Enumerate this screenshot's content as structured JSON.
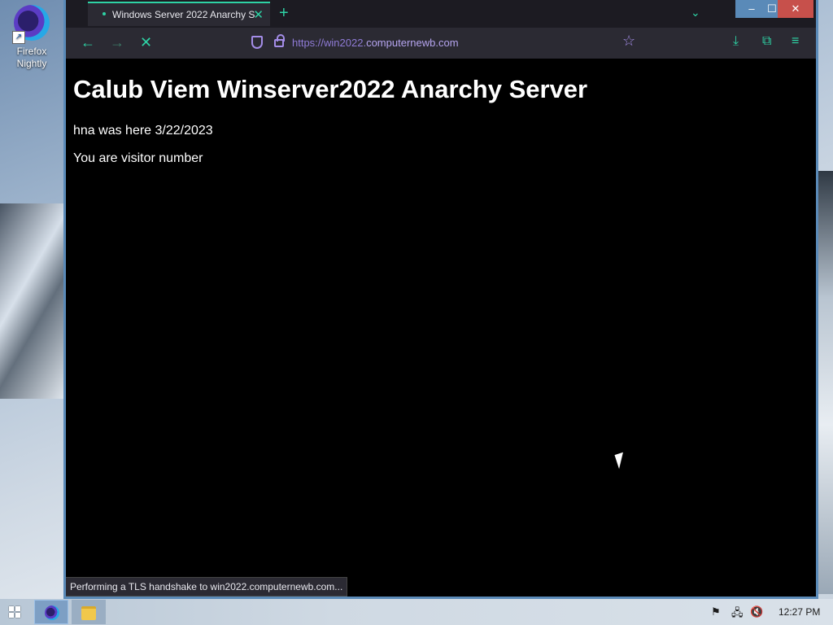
{
  "desktop": {
    "icon_label_line1": "Firefox",
    "icon_label_line2": "Nightly"
  },
  "browser": {
    "tab_title": "Windows Server 2022 Anarchy S",
    "url_scheme": "https://",
    "url_sub": "win2022.",
    "url_host": "computernewb.com",
    "status_text": "Performing a TLS handshake to win2022.computernewb.com..."
  },
  "page": {
    "heading": "Calub Viem Winserver2022 Anarchy Server",
    "line1": "hna was here 3/22/2023",
    "line2": "You are visitor number"
  },
  "taskbar": {
    "clock": "12:27 PM"
  },
  "colors": {
    "accent": "#2ed3a5",
    "url": "#a48de8",
    "window_border": "#5a8ab8",
    "close": "#c7504b"
  },
  "icons": [
    "firefox-nightly-icon",
    "back-icon",
    "forward-icon",
    "stop-icon",
    "shield-icon",
    "lock-icon",
    "star-icon",
    "download-icon",
    "extensions-icon",
    "menu-icon",
    "windows-start-icon",
    "file-explorer-icon",
    "flag-icon",
    "network-icon",
    "volume-muted-icon"
  ]
}
